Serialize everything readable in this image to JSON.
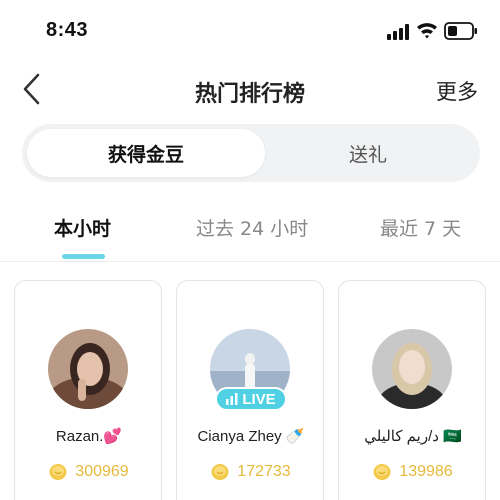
{
  "status_bar": {
    "time": "8:43"
  },
  "nav": {
    "title": "热门排行榜",
    "more_label": "更多"
  },
  "segment": {
    "active_label": "获得金豆",
    "inactive_label": "送礼"
  },
  "tabs": [
    {
      "label": "本小时"
    },
    {
      "label": "过去 24 小时"
    },
    {
      "label": "最近 7 天"
    }
  ],
  "cards": [
    {
      "name": "Razan.💕",
      "value": "300969"
    },
    {
      "name": "Cianya Zhey 🍼",
      "value": "172733",
      "live_label": "LIVE"
    },
    {
      "name": "د/ريم كاليلي 🇸🇦",
      "value": "139986"
    }
  ],
  "colors": {
    "accent": "#6ad6e6",
    "live": "#4fd0e3",
    "coin": "#e6b93a"
  }
}
